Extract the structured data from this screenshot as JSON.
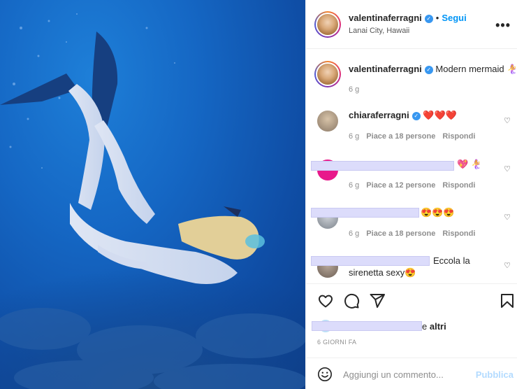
{
  "header": {
    "username": "valentinaferragni",
    "verified_glyph": "✓",
    "separator": "•",
    "follow_label": "Segui",
    "location": "Lanai City, Hawaii",
    "more_glyph": "•••"
  },
  "caption": {
    "username": "valentinaferragni",
    "text": "Modern mermaid 🧜‍♀️",
    "time": "6 g"
  },
  "comments": [
    {
      "username": "chiaraferragni",
      "text": "❤️❤️❤️",
      "time": "6 g",
      "likes": "Piace a 18 persone",
      "reply": "Rispondi"
    },
    {
      "username": "",
      "text": "💖 🧜‍♀️",
      "time": "6 g",
      "likes": "Piace a 12 persone",
      "reply": "Rispondi"
    },
    {
      "username": "",
      "text": "😍😍😍",
      "time": "6 g",
      "likes": "Piace a 18 persone",
      "reply": "Rispondi"
    },
    {
      "username": "",
      "text": "Eccola la",
      "text2": "sirenetta sexy😍"
    }
  ],
  "likes": {
    "suffix": "e",
    "others": "altri",
    "date": "6 GIORNI FA"
  },
  "composer": {
    "emoji_icon": "smile-icon",
    "placeholder": "Aggiungi un commento...",
    "publish_label": "Pubblica"
  },
  "colors": {
    "accent": "#0095f6",
    "publish_disabled": "#b3dbff",
    "verified": "#3897f0"
  }
}
